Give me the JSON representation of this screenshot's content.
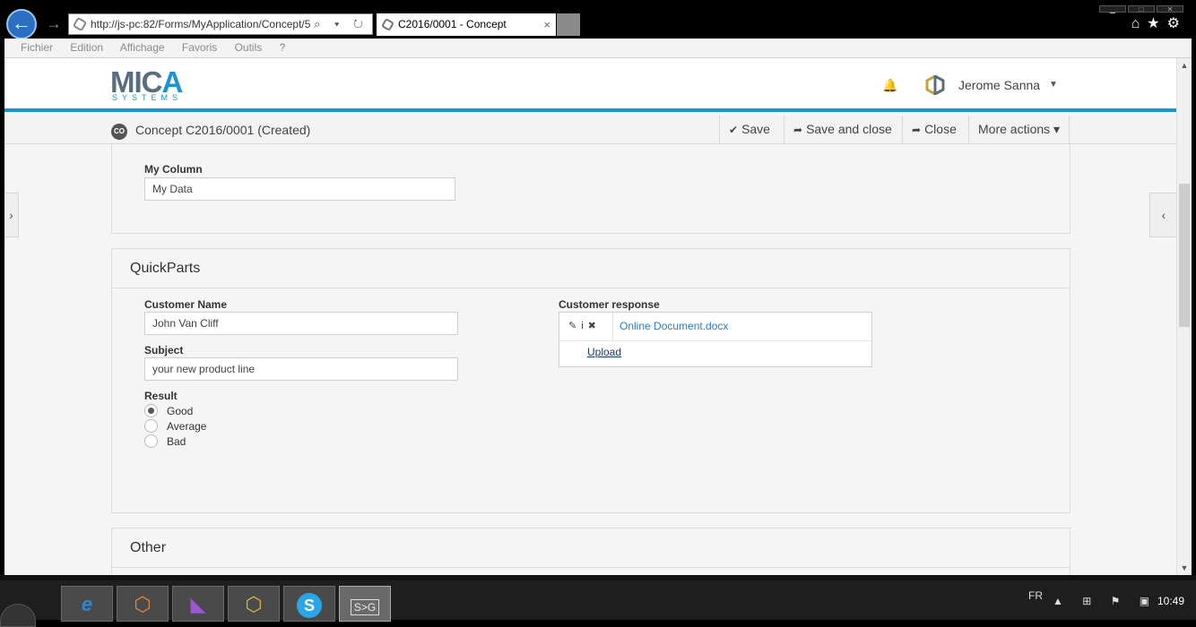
{
  "browser": {
    "url": "http://js-pc:82/Forms/MyApplication/Concept/5",
    "tab_title": "C2016/0001 - Concept",
    "tab_close": "×",
    "back": "←",
    "forward": "→",
    "address_tools": "⌕ ▾ ↻",
    "toolbar_icons": "⌂★⚙",
    "window_buttons": [
      "▁",
      "□",
      "✕"
    ]
  },
  "menu": {
    "items": [
      "Fichier",
      "Edition",
      "Affichage",
      "Favoris",
      "Outils",
      "?"
    ]
  },
  "header": {
    "logo_main": "MIC",
    "logo_accent": "A",
    "logo_sub": "SYSTEMS",
    "bell_icon": "🔔",
    "user_name": "Jerome Sanna",
    "user_caret": "▼"
  },
  "toolbar": {
    "badge": "CO",
    "title": "Concept C2016/0001 (Created)",
    "save_icon": "✔",
    "save": "Save",
    "save_close_icon": "➦",
    "save_close": "Save and close",
    "close_icon": "➦",
    "close": "Close",
    "more": "More actions ▾"
  },
  "side": {
    "left": "›",
    "right": "‹"
  },
  "section_top": {
    "label": "My Column",
    "value": "My Data"
  },
  "quickparts": {
    "title": "QuickParts",
    "customer_name_label": "Customer Name",
    "customer_name_value": "John Van Cliff",
    "subject_label": "Subject",
    "subject_value": "your new product line",
    "result_label": "Result",
    "result_options": [
      "Good",
      "Average",
      "Bad"
    ],
    "result_selected": "Good",
    "response_label": "Customer response",
    "attach_tools": "✎i✖",
    "file_name": "Online Document.docx",
    "upload": "Upload"
  },
  "other": {
    "title": "Other"
  },
  "scroll": {
    "up": "▲",
    "down": "▼"
  },
  "taskbar": {
    "apps": [
      {
        "name": "internet-explorer",
        "glyph": "e",
        "color": "#2a8ad8"
      },
      {
        "name": "mica-app-1",
        "glyph": "⬡",
        "color": "#e08a3c"
      },
      {
        "name": "visual-studio",
        "glyph": "◣",
        "color": "#9b59d0"
      },
      {
        "name": "mica-app-2",
        "glyph": "⬡",
        "color": "#d8b44a"
      },
      {
        "name": "skype",
        "glyph": "S",
        "color": "#2aa6e8"
      },
      {
        "name": "powershell",
        "glyph": "S>G",
        "color": "#dddddd"
      }
    ],
    "lang": "FR",
    "tray": "▲ ⊞ ⚑ ▣",
    "clock": "10:49"
  },
  "colors": {
    "accent": "#1d94d2",
    "link": "#2a7fc1"
  }
}
